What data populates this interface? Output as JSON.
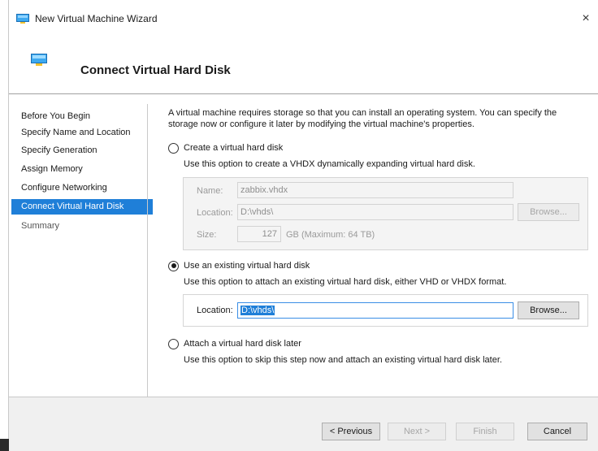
{
  "window": {
    "title": "New Virtual Machine Wizard",
    "close_glyph": "×"
  },
  "header": {
    "title": "Connect Virtual Hard Disk"
  },
  "nav": {
    "items": [
      {
        "label": "Before You Begin"
      },
      {
        "label": "Specify Name and Location"
      },
      {
        "label": "Specify Generation"
      },
      {
        "label": "Assign Memory"
      },
      {
        "label": "Configure Networking"
      },
      {
        "label": "Connect Virtual Hard Disk"
      },
      {
        "label": "Summary"
      }
    ],
    "active_index": 5
  },
  "content": {
    "description": "A virtual machine requires storage so that you can install an operating system. You can specify the storage now or configure it later by modifying the virtual machine's properties.",
    "create_option": {
      "label": "Create a virtual hard disk",
      "hint": "Use this option to create a VHDX dynamically expanding virtual hard disk.",
      "selected": false,
      "name_label": "Name:",
      "name_value": "zabbix.vhdx",
      "location_label": "Location:",
      "location_value": "D:\\vhds\\",
      "browse_label": "Browse...",
      "size_label": "Size:",
      "size_value": "127",
      "size_suffix": "GB (Maximum: 64 TB)"
    },
    "existing_option": {
      "label": "Use an existing virtual hard disk",
      "hint": "Use this option to attach an existing virtual hard disk, either VHD or VHDX format.",
      "selected": true,
      "location_label": "Location:",
      "location_value": "D:\\vhds\\",
      "browse_label": "Browse..."
    },
    "later_option": {
      "label": "Attach a virtual hard disk later",
      "hint": "Use this option to skip this step now and attach an existing virtual hard disk later.",
      "selected": false
    }
  },
  "footer": {
    "previous_label": "< Previous",
    "next_label": "Next >",
    "finish_label": "Finish",
    "cancel_label": "Cancel"
  },
  "colors": {
    "accent": "#1f7fd8",
    "footer_bg": "#f0f0f0",
    "disabled_text": "#9a9a9a"
  }
}
